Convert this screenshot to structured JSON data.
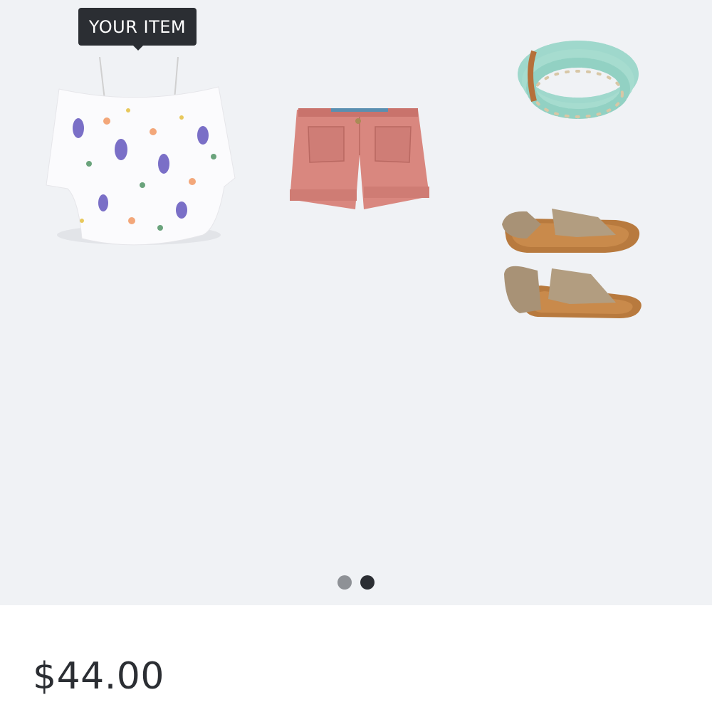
{
  "tooltip": {
    "label": "YOUR ITEM"
  },
  "items": [
    {
      "name": "floral-off-shoulder-top-image"
    },
    {
      "name": "pink-shorts-image"
    },
    {
      "name": "turquoise-bead-bracelet-image"
    },
    {
      "name": "tan-sandals-image"
    }
  ],
  "carousel": {
    "pages": 2,
    "active_index": 1
  },
  "colors": {
    "background": "#f0f2f5",
    "tooltip": "#2b2e33",
    "dot_inactive": "#8e9196",
    "dot_active": "#2b2e33"
  },
  "price": "$44.00"
}
